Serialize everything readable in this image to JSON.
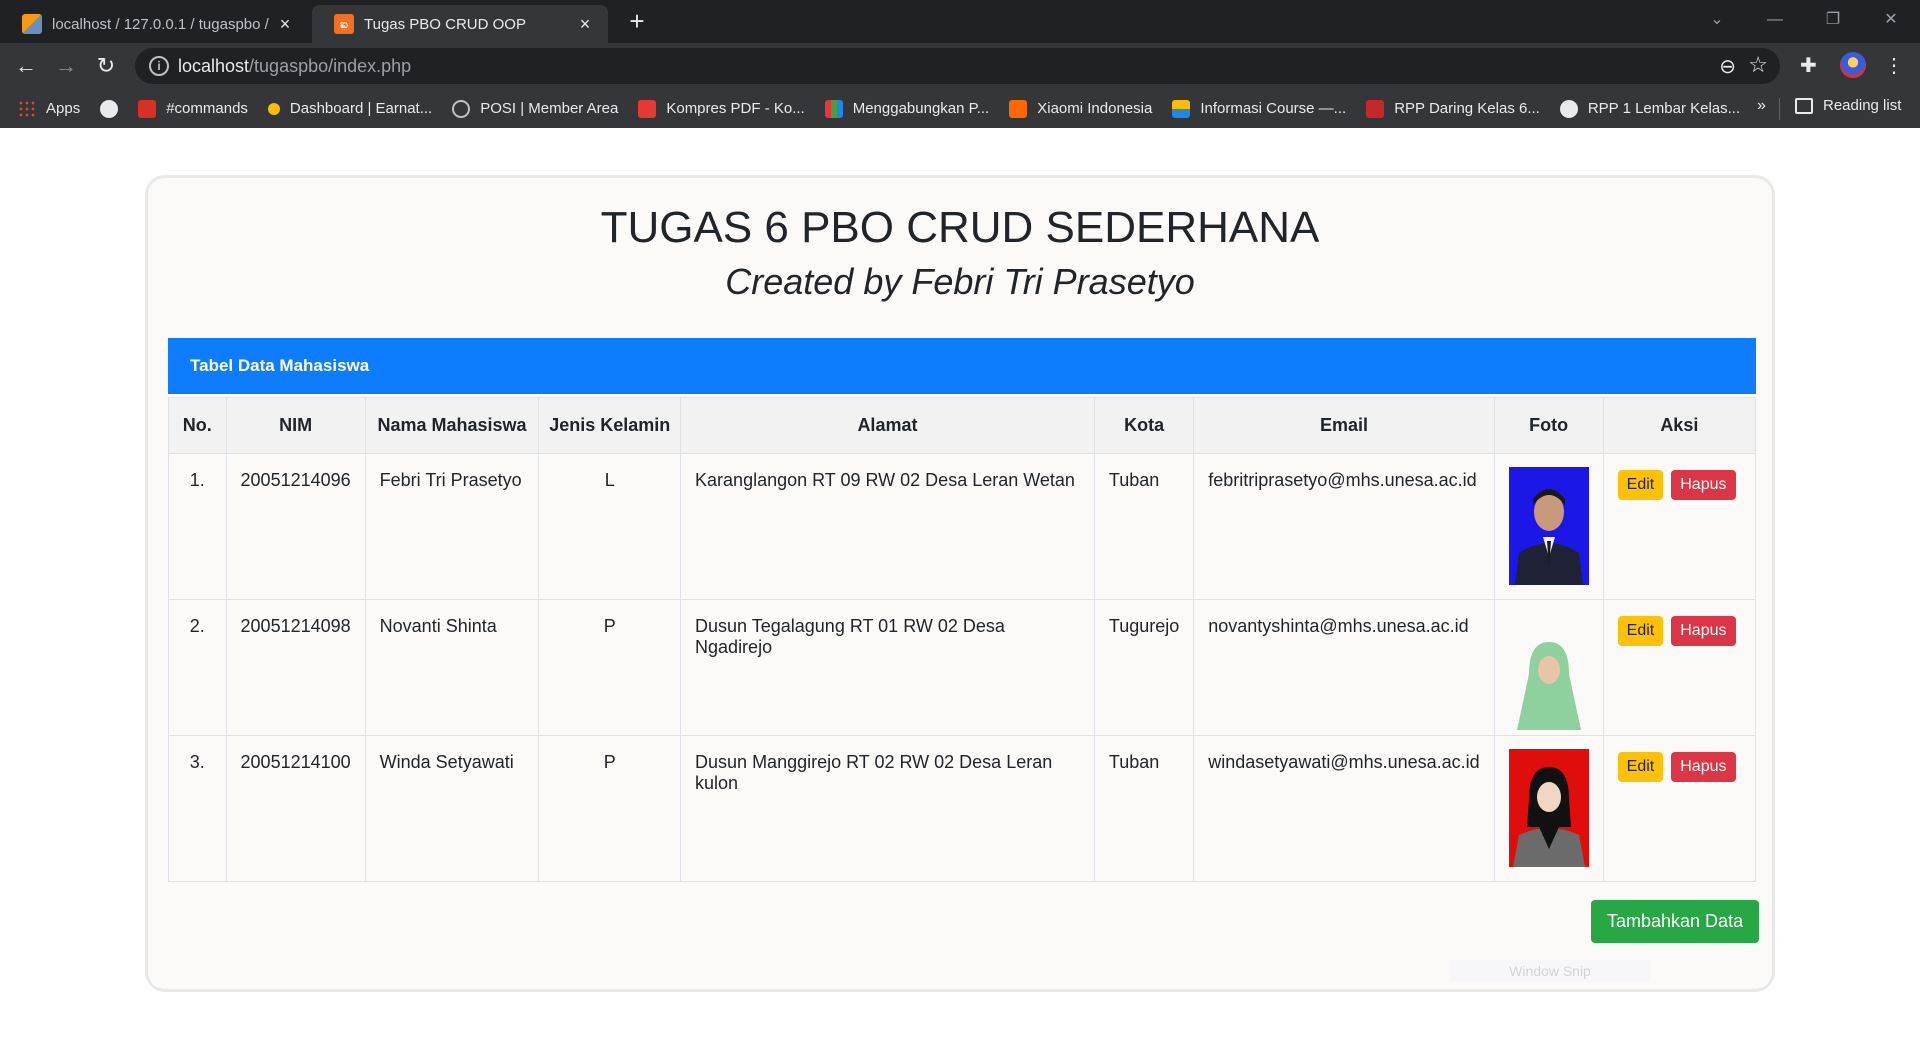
{
  "browser": {
    "tabs": [
      {
        "title": "localhost / 127.0.0.1 / tugaspbo /",
        "active": false
      },
      {
        "title": "Tugas PBO CRUD OOP",
        "active": true
      }
    ],
    "url_host": "localhost",
    "url_path": "/tugaspbo/index.php",
    "bookmarks": [
      "Apps",
      "#commands",
      "Dashboard | Earnat...",
      "POSI | Member Area",
      "Kompres PDF - Ko...",
      "Menggabungkan P...",
      "Xiaomi Indonesia",
      "Informasi Course —...",
      "RPP Daring Kelas 6...",
      "RPP 1 Lembar Kelas..."
    ],
    "bookmarks_more": "»",
    "reading_list": "Reading list",
    "colors": {
      "chrome": "#202124",
      "toolbar": "#35363a"
    }
  },
  "page": {
    "title": "TUGAS 6 PBO CRUD SEDERHANA",
    "subtitle": "Created by Febri Tri Prasetyo",
    "panel_title": "Tabel Data Mahasiswa",
    "columns": [
      "No.",
      "NIM",
      "Nama Mahasiswa",
      "Jenis Kelamin",
      "Alamat",
      "Kota",
      "Email",
      "Foto",
      "Aksi"
    ],
    "rows": [
      {
        "no": "1.",
        "nim": "20051214096",
        "nama": "Febri Tri Prasetyo",
        "jk": "L",
        "alamat": "Karanglangon RT 09 RW 02 Desa Leran Wetan",
        "kota": "Tuban",
        "email": "febritriprasetyo@mhs.unesa.ac.id",
        "edit": "Edit",
        "hapus": "Hapus"
      },
      {
        "no": "2.",
        "nim": "20051214098",
        "nama": "Novanti Shinta",
        "jk": "P",
        "alamat": "Dusun Tegalagung RT 01 RW 02 Desa Ngadirejo",
        "kota": "Tugurejo",
        "email": "novantyshinta@mhs.unesa.ac.id",
        "edit": "Edit",
        "hapus": "Hapus"
      },
      {
        "no": "3.",
        "nim": "20051214100",
        "nama": "Winda Setyawati",
        "jk": "P",
        "alamat": "Dusun Manggirejo RT 02 RW 02 Desa Leran kulon",
        "kota": "Tuban",
        "email": "windasetyawati@mhs.unesa.ac.id",
        "edit": "Edit",
        "hapus": "Hapus"
      }
    ],
    "add_button": "Tambahkan Data",
    "ghost_label": "Window Snip",
    "colors": {
      "panel": "#0d7dfe",
      "edit": "#ffc107",
      "delete": "#dc3545",
      "add": "#28a745"
    }
  }
}
